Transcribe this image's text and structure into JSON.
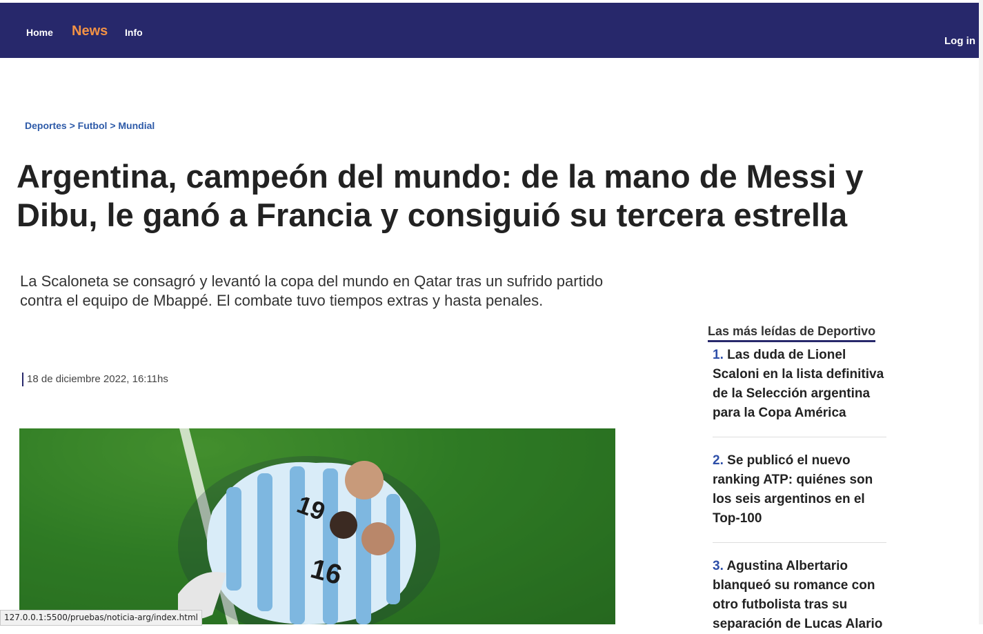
{
  "nav": {
    "home": "Home",
    "news": "News",
    "info": "Info",
    "login": "Log in"
  },
  "breadcrumb": {
    "items": [
      "Deportes",
      "Futbol",
      "Mundial"
    ],
    "separator": ">"
  },
  "article": {
    "headline": "Argentina, campeón del mundo: de la mano de Messi y Dibu, le ganó a Francia y consiguió su tercera estrella",
    "subhead": "La Scaloneta se consagró y levantó la copa del mundo en Qatar tras un sufrido partido contra el equipo de Mbappé. El combate tuvo tiempos extras y hasta penales.",
    "date": "18 de diciembre 2022, 16:11hs"
  },
  "sidebar": {
    "title": "Las más leídas de Deportivo",
    "items": [
      {
        "num": "1.",
        "text": "Las duda de Lionel Scaloni en la lista definitiva de la Selección argentina para la Copa América"
      },
      {
        "num": "2.",
        "text": "Se publicó el nuevo ranking ATP: quiénes son los seis argentinos en el Top-100"
      },
      {
        "num": "3.",
        "text": "Agustina Albertario blanqueó su romance con otro futbolista tras su separación de Lucas Alario"
      }
    ]
  },
  "status_bar": {
    "url": "127.0.0.1:5500/pruebas/noticia-arg/index.html"
  },
  "colors": {
    "topbar": "#27286b",
    "news_accent": "#f39245",
    "link_blue": "#2d5aa8"
  }
}
